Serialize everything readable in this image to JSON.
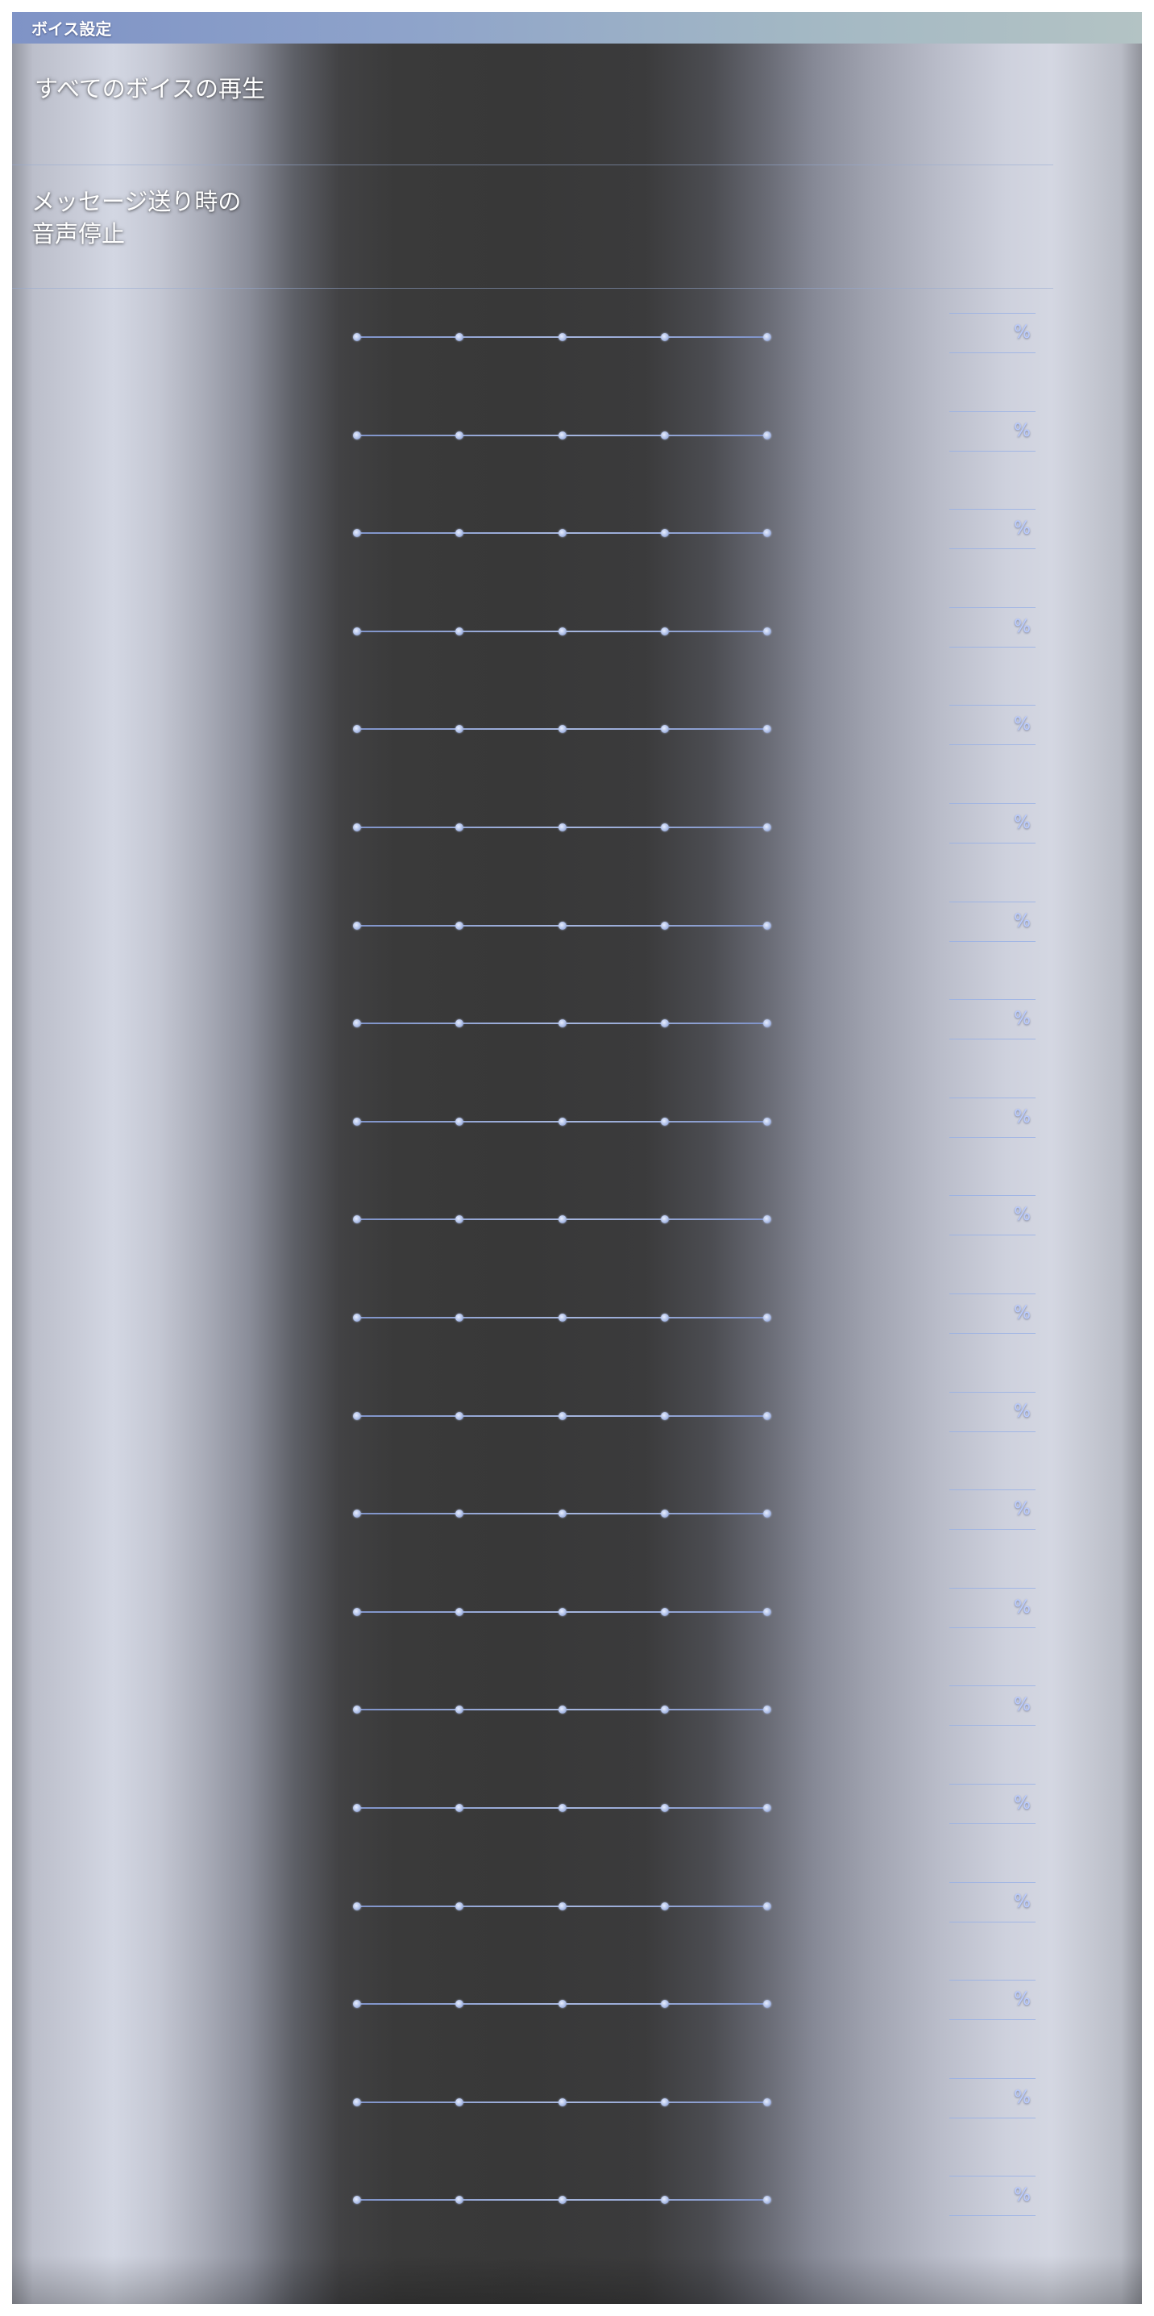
{
  "window": {
    "title": "ボイス設定"
  },
  "settings": [
    {
      "label": "すべてのボイスの再生"
    },
    {
      "label": "メッセージ送り時の\n音声停止"
    }
  ],
  "sliders": {
    "count": 20,
    "stops": 5,
    "unit": "%"
  },
  "colors": {
    "title_bar_start": "#7f93c6",
    "title_bar_end": "#b3c3c4",
    "accent": "#a6b6de",
    "percent_text": "#b9cbff"
  }
}
